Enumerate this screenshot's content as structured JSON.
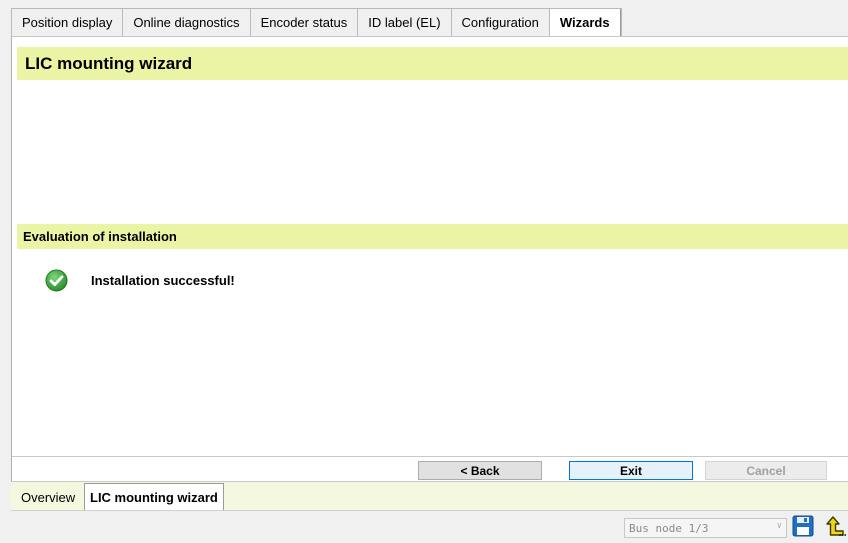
{
  "top_tabs": [
    {
      "label": "Position display"
    },
    {
      "label": "Online diagnostics"
    },
    {
      "label": "Encoder status"
    },
    {
      "label": "ID label (EL)"
    },
    {
      "label": "Configuration"
    },
    {
      "label": "Wizards",
      "active": true
    }
  ],
  "wizard": {
    "title": "LIC mounting wizard",
    "section_title": "Evaluation of installation",
    "status_icon": "check-circle-icon",
    "status_message": "Installation successful!"
  },
  "buttons": {
    "back": "< Back",
    "exit": "Exit",
    "cancel": "Cancel"
  },
  "bottom_tabs": [
    {
      "label": "Overview"
    },
    {
      "label": "LIC mounting wizard",
      "active": true
    }
  ],
  "status_bar": {
    "bus_node": "Bus node 1/3",
    "save_icon": "save-disk-icon",
    "up_icon": "up-arrow-icon"
  },
  "colors": {
    "header_bar": "#ebf4a4",
    "bottom_tab_bg": "#f4f8de",
    "success_green": "#3aa63a",
    "exit_border": "#0078d7"
  }
}
